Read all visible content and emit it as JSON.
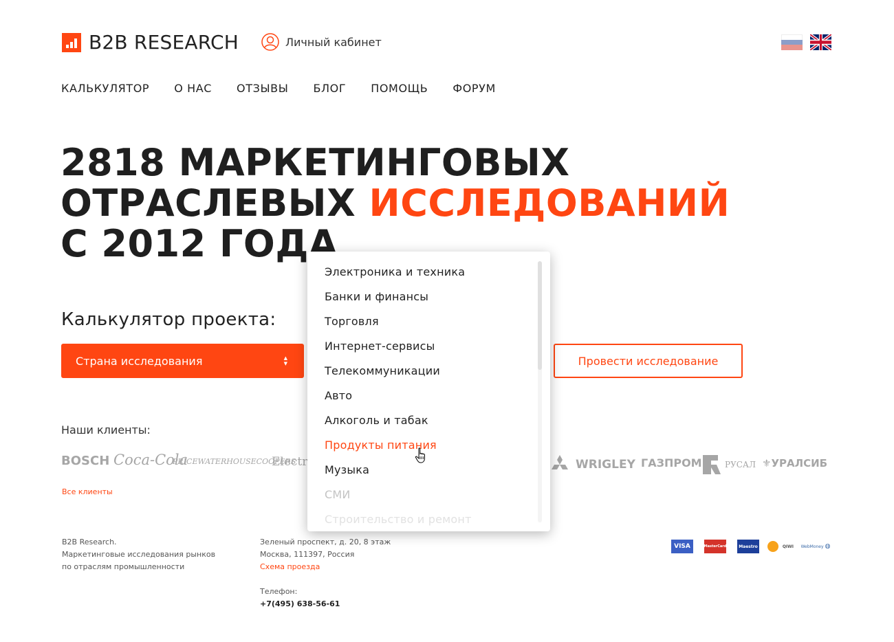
{
  "brand": {
    "name": "B2B RESEARCH",
    "accent_color": "#ff4612"
  },
  "header": {
    "cabinet_label": "Личный кабинет",
    "cabinet_icon": "user-icon",
    "flags": [
      "russia-flag-icon",
      "uk-flag-icon"
    ]
  },
  "nav": [
    "КАЛЬКУЛЯТОР",
    "О НАС",
    "ОТЗЫВЫ",
    "БЛОГ",
    "ПОМОЩЬ",
    "ФОРУМ"
  ],
  "hero": {
    "line1": "2818 МАРКЕТИНГОВЫХ",
    "line2_plain": "ОТРАСЛЕВЫХ",
    "line2_accent": "ИССЛЕДОВАНИЙ",
    "line3": "С 2012 ГОДА"
  },
  "calculator": {
    "title": "Калькулятор проекта:",
    "country_select": "Страна исследования",
    "run_button": "Провести исследование"
  },
  "dropdown": {
    "items": [
      "Электроника и техника",
      "Банки и финансы",
      "Торговля",
      "Интернет-сервисы",
      "Телекоммуникации",
      "Авто",
      "Алкоголь и табак",
      "Продукты питания",
      "Музыка",
      "СМИ",
      "Строительство и ремонт"
    ],
    "hovered": "Продукты питания"
  },
  "clients": {
    "title": "Наши клиенты:",
    "logos": [
      "BOSCH",
      "Coca-Cola",
      "PRICEWATERHOUSECOOPERS",
      "Electro",
      "WRIGLEY",
      "ГАЗПРОМ",
      "РУСАЛ",
      "УРАЛСИБ"
    ],
    "all_link": "Все клиенты"
  },
  "footer": {
    "company_line1": "B2B Research.",
    "company_line2": "Маркетинговые исследования рынков",
    "company_line3": "по отраслям промышленности",
    "address_line1": "Зеленый проспект, д. 20, 8 этаж",
    "address_line2": "Москва, 111397, Россия",
    "map_link": "Схема проезда",
    "phone_label": "Телефон:",
    "phone": "+7(495) 638-56-61",
    "payments": [
      "VISA",
      "MasterCard",
      "Maestro",
      "QIWI",
      "WebMoney"
    ]
  }
}
